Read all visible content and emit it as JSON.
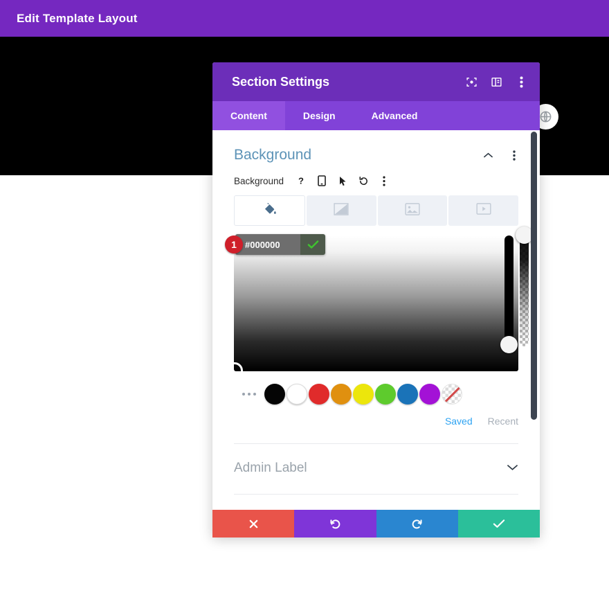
{
  "topbar": {
    "title": "Edit Template Layout",
    "bg_color": "#7528c0"
  },
  "hero": {
    "bg_color": "#000000"
  },
  "round_button": {
    "icon": "globe-icon"
  },
  "modal": {
    "title": "Section Settings",
    "header_icons": [
      {
        "name": "focus-target-icon"
      },
      {
        "name": "layout-panel-icon"
      },
      {
        "name": "more-vertical-icon"
      }
    ],
    "tabs": [
      {
        "label": "Content",
        "active": true
      },
      {
        "label": "Design",
        "active": false
      },
      {
        "label": "Advanced",
        "active": false
      }
    ],
    "section": {
      "title": "Background",
      "collapse_icon": "chevron-up-icon",
      "menu_icon": "more-vertical-icon"
    },
    "field": {
      "label": "Background",
      "icons": [
        {
          "name": "help-icon",
          "glyph": "?"
        },
        {
          "name": "mobile-icon"
        },
        {
          "name": "cursor-icon"
        },
        {
          "name": "reset-icon"
        },
        {
          "name": "more-vertical-icon"
        }
      ]
    },
    "bg_tabs": [
      {
        "name": "bg-color-tab",
        "icon": "paint-bucket-icon",
        "active": true
      },
      {
        "name": "bg-gradient-tab",
        "icon": "gradient-icon",
        "active": false
      },
      {
        "name": "bg-image-tab",
        "icon": "image-icon",
        "active": false
      },
      {
        "name": "bg-video-tab",
        "icon": "video-icon",
        "active": false
      }
    ],
    "color_picker": {
      "badge": "1",
      "hex_value": "#000000",
      "hex_placeholder": "#000000",
      "confirm_icon": "check-icon",
      "hue_slider": {
        "name": "hue-slider",
        "handle_position": "bottom"
      },
      "alpha_slider": {
        "name": "alpha-slider",
        "handle_position": "top"
      }
    },
    "swatches": [
      {
        "name": "swatch-black",
        "color": "#050505"
      },
      {
        "name": "swatch-white",
        "color": "#ffffff"
      },
      {
        "name": "swatch-red",
        "color": "#e02b2b"
      },
      {
        "name": "swatch-orange",
        "color": "#e0900f"
      },
      {
        "name": "swatch-yellow",
        "color": "#ece60c"
      },
      {
        "name": "swatch-green",
        "color": "#5ecb2d"
      },
      {
        "name": "swatch-blue",
        "color": "#1a73b8"
      },
      {
        "name": "swatch-purple",
        "color": "#a312d6"
      },
      {
        "name": "swatch-transparent",
        "color": "transparent"
      }
    ],
    "palette_tabs": {
      "saved": "Saved",
      "recent": "Recent",
      "saved_color": "#2ea3f2",
      "recent_color": "#a8b0b9"
    },
    "admin_label": {
      "label": "Admin Label",
      "expand_icon": "chevron-down-icon"
    },
    "footer_buttons": [
      {
        "name": "cancel-button",
        "icon": "close-icon",
        "color": "#e9544a"
      },
      {
        "name": "undo-button",
        "icon": "undo-icon",
        "color": "#7f35d8"
      },
      {
        "name": "redo-button",
        "icon": "redo-icon",
        "color": "#2a86d0"
      },
      {
        "name": "save-button",
        "icon": "check-icon",
        "color": "#2bbf9a"
      }
    ]
  }
}
